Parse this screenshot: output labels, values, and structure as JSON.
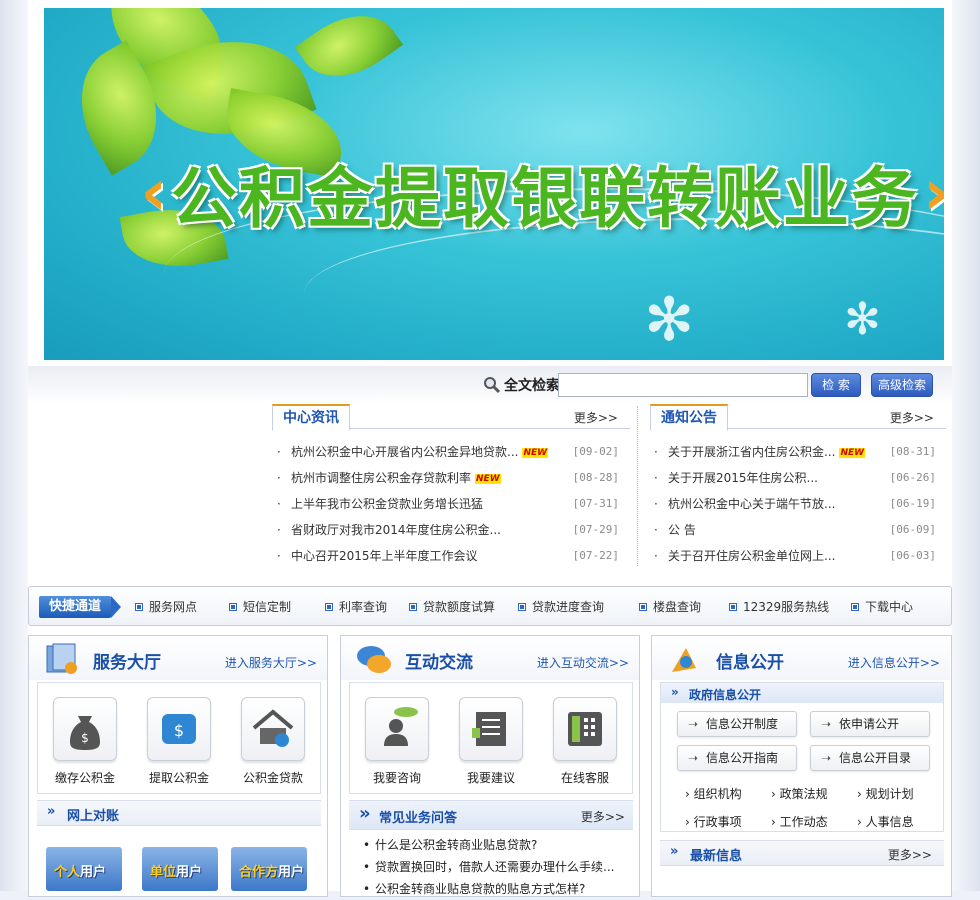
{
  "banner": {
    "title": "公积金提取银联转账业务",
    "left_mark": "‹",
    "right_mark": "›"
  },
  "search": {
    "label": "全文检索",
    "search_button": "检 索",
    "advanced_button": "高级检索",
    "placeholder": ""
  },
  "center_news": {
    "title": "中心资讯",
    "more": "更多>>",
    "items": [
      {
        "text": "杭州公积金中心开展省内公积金异地贷款...",
        "date": "[09-02]",
        "new": "NEW"
      },
      {
        "text": "杭州市调整住房公积金存贷款利率",
        "date": "[08-28]",
        "new": "NEW"
      },
      {
        "text": "上半年我市公积金贷款业务增长迅猛",
        "date": "[07-31]",
        "new": ""
      },
      {
        "text": "省财政厅对我市2014年度住房公积金...",
        "date": "[07-29]",
        "new": ""
      },
      {
        "text": "中心召开2015年上半年度工作会议",
        "date": "[07-22]",
        "new": ""
      }
    ]
  },
  "notices": {
    "title": "通知公告",
    "more": "更多>>",
    "items": [
      {
        "text": "关于开展浙江省内住房公积金...",
        "date": "[08-31]",
        "new": "NEW"
      },
      {
        "text": "关于开展2015年住房公积...",
        "date": "[06-26]",
        "new": ""
      },
      {
        "text": "杭州公积金中心关于端午节放...",
        "date": "[06-19]",
        "new": ""
      },
      {
        "text": "公 告",
        "date": "[06-09]",
        "new": ""
      },
      {
        "text": "关于召开住房公积金单位网上...",
        "date": "[06-03]",
        "new": ""
      }
    ]
  },
  "quick": {
    "title": "快捷通道",
    "items": [
      "服务网点",
      "短信定制",
      "利率查询",
      "贷款额度试算",
      "贷款进度查询",
      "楼盘查询",
      "12329服务热线",
      "下载中心"
    ]
  },
  "service_hall": {
    "title": "服务大厅",
    "enter": "进入服务大厅>>",
    "items": [
      "缴存公积金",
      "提取公积金",
      "公积金贷款"
    ],
    "online_title": "网上对账",
    "users": [
      {
        "a": "个人",
        "b": "用户"
      },
      {
        "a": "单位",
        "b": "用户"
      },
      {
        "a": "合作方",
        "b": "用户"
      }
    ]
  },
  "interaction": {
    "title": "互动交流",
    "enter": "进入互动交流>>",
    "items": [
      "我要咨询",
      "我要建议",
      "在线客服"
    ],
    "faq_title": "常见业务问答",
    "faq_more": "更多>>",
    "faq": [
      "什么是公积金转商业贴息贷款?",
      "贷款置换回时，借款人还需要办理什么手续...",
      "公积金转商业贴息贷款的贴息方式怎样?"
    ]
  },
  "info": {
    "title": "信息公开",
    "enter": "进入信息公开>>",
    "gov_title": "政府信息公开",
    "buttons": [
      "信息公开制度",
      "依申请公开",
      "信息公开指南",
      "信息公开目录"
    ],
    "links": [
      "组织机构",
      "政策法规",
      "规划计划",
      "行政事项",
      "工作动态",
      "人事信息"
    ],
    "latest_title": "最新信息",
    "latest_more": "更多>>"
  },
  "colors": {
    "accent": "#1f57b3",
    "tab_top": "#e49a1e",
    "new_bg": "#ffe600",
    "banner_green": "#4cb620"
  }
}
